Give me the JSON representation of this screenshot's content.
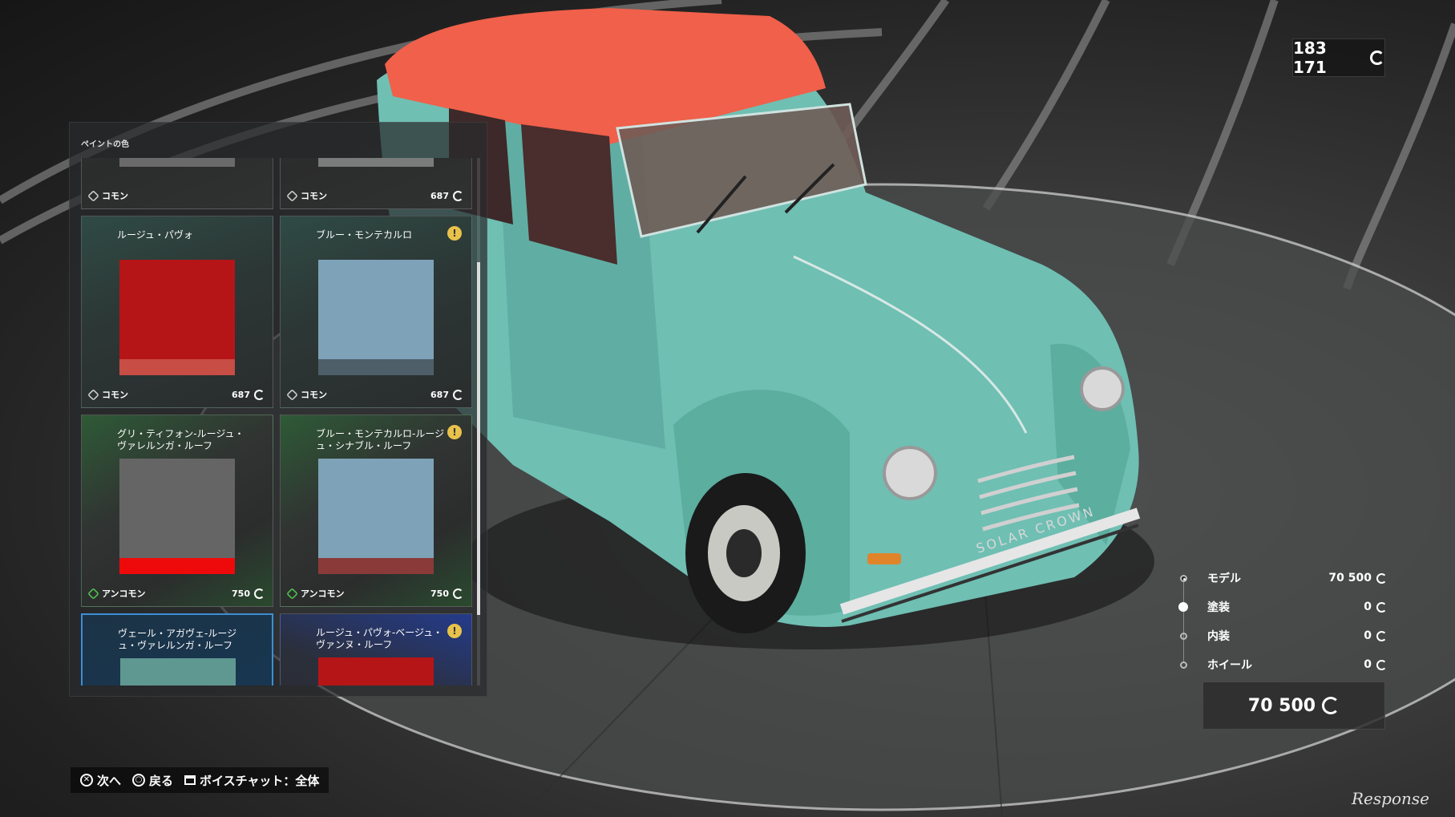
{
  "wallet": {
    "amount": "183 171"
  },
  "panel": {
    "title": "ペイントの色",
    "cards": [
      {
        "name": "",
        "rarity": "コモン",
        "price": "",
        "swatch_top": "#6a6a6a",
        "swatch_bottom": "#6a6a6a",
        "locked": false
      },
      {
        "name": "",
        "rarity": "コモン",
        "price": "687",
        "swatch_top": "#7a7b7b",
        "swatch_bottom": "#7a7b7b",
        "locked": false
      },
      {
        "name": "ルージュ・パヴォ",
        "rarity": "コモン",
        "price": "687",
        "swatch_top": "#b51517",
        "swatch_bottom": "#c74d45",
        "locked": false
      },
      {
        "name": "ブルー・モンテカルロ",
        "rarity": "コモン",
        "price": "687",
        "swatch_top": "#7ea2b8",
        "swatch_bottom": "#4e5f6a",
        "locked": true
      },
      {
        "name": "グリ・ティフォン-ルージュ・ヴァレルンガ・ルーフ",
        "rarity": "アンコモン",
        "price": "750",
        "swatch_top": "#666566",
        "swatch_bottom": "#ee0a0a",
        "locked": false
      },
      {
        "name": "ブルー・モンテカルロ-ルージュ・シナブル・ルーフ",
        "rarity": "アンコモン",
        "price": "750",
        "swatch_top": "#7ea2b8",
        "swatch_bottom": "#8a3a38",
        "locked": true
      },
      {
        "name": "ヴェール・アガヴェ-ルージュ・ヴァレルンガ・ルーフ",
        "rarity": "",
        "price": "",
        "swatch_top": "#5f9891",
        "swatch_bottom": "#5f9891",
        "locked": false
      },
      {
        "name": "ルージュ・パヴォ-ベージュ・ヴァンヌ・ルーフ",
        "rarity": "",
        "price": "",
        "swatch_top": "#b51517",
        "swatch_bottom": "#b51517",
        "locked": true
      }
    ]
  },
  "costs": [
    {
      "label": "モデル",
      "value": "70 500"
    },
    {
      "label": "塗装",
      "value": "0"
    },
    {
      "label": "内装",
      "value": "0"
    },
    {
      "label": "ホイール",
      "value": "0"
    }
  ],
  "total": "70 500",
  "hints": {
    "next": "次へ",
    "back": "戻る",
    "voice": "ボイスチャット：全体"
  },
  "watermark": "Response",
  "car": {
    "body_color": "#6fbfb3",
    "roof_color": "#f0604a",
    "plate_text": "SOLAR CROWN"
  }
}
